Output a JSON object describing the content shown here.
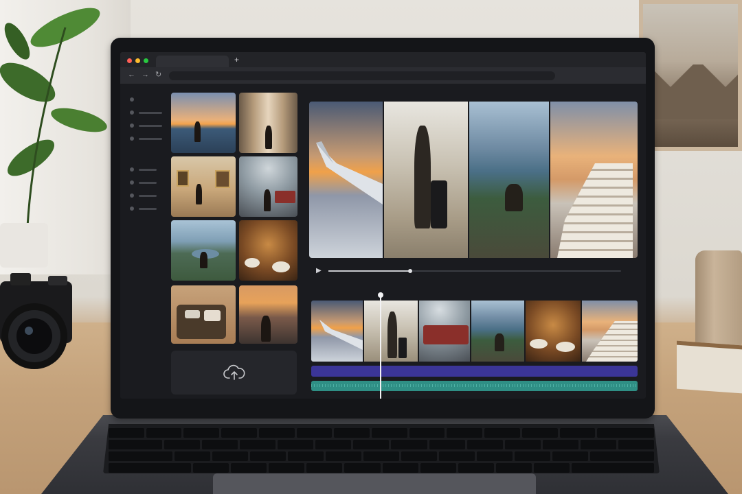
{
  "browser": {
    "window_controls": {
      "close_color": "#ff5f57",
      "minimize_color": "#febc2e",
      "maximize_color": "#28c840"
    },
    "new_tab_label": "+",
    "back_icon": "←",
    "forward_icon": "→",
    "reload_icon": "↻"
  },
  "media_panel": {
    "thumbnails": [
      {
        "icon": "sunset-beach-traveler-photo"
      },
      {
        "icon": "city-street-walker-photo"
      },
      {
        "icon": "art-gallery-visitor-photo"
      },
      {
        "icon": "train-station-platform-photo"
      },
      {
        "icon": "mountain-lake-hiker-photo"
      },
      {
        "icon": "restaurant-dinner-table-photo"
      },
      {
        "icon": "packing-suitcase-photo"
      },
      {
        "icon": "mountain-sunset-viewer-photo"
      }
    ],
    "upload_icon": "cloud-upload-icon"
  },
  "preview": {
    "clips": [
      {
        "icon": "airplane-wing-sunset"
      },
      {
        "icon": "airport-walker-suitcase"
      },
      {
        "icon": "mountain-lake-sitter"
      },
      {
        "icon": "santorini-village"
      }
    ],
    "play_icon": "▶",
    "progress": 0.28
  },
  "timeline": {
    "clips": [
      {
        "icon": "airplane-wing-sunset"
      },
      {
        "icon": "airport-walker-suitcase"
      },
      {
        "icon": "train-station-platform"
      },
      {
        "icon": "mountain-lake-sitter"
      },
      {
        "icon": "restaurant-dinner-table"
      },
      {
        "icon": "santorini-village"
      }
    ],
    "video_track_color": "#3b3597",
    "audio_track_color": "#2f8f85",
    "playhead_position": 0.21
  }
}
